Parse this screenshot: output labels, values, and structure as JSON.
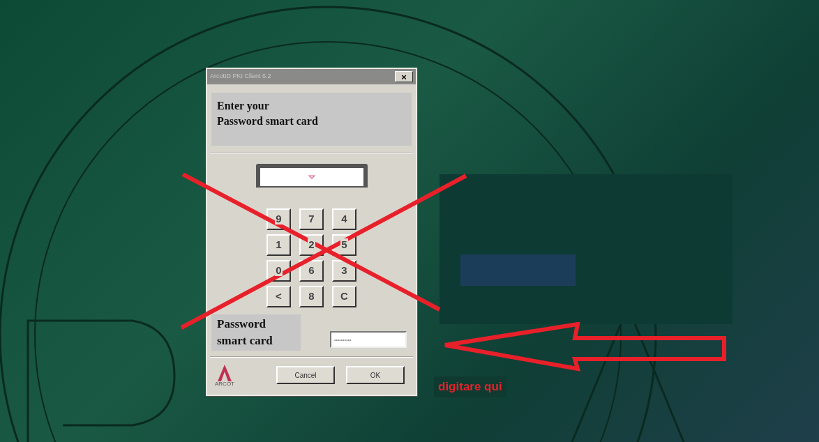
{
  "window": {
    "title": "ArcotID PKI Client 6.2",
    "close": "×"
  },
  "prompt": "Enter your\nPassword smart card",
  "keypad": [
    [
      "9",
      "7",
      "4"
    ],
    [
      "1",
      "2",
      "5"
    ],
    [
      "0",
      "6",
      "3"
    ],
    [
      "<",
      "8",
      "C"
    ]
  ],
  "password": {
    "label": "Password\nsmart card",
    "value": "••••••••••"
  },
  "logo": "ARCOT",
  "buttons": [
    "Cancel",
    "OK"
  ],
  "annotation": {
    "caption": "digitare qui"
  }
}
